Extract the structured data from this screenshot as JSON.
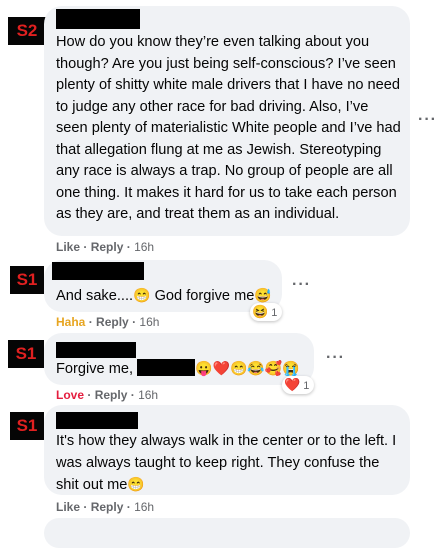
{
  "comments": [
    {
      "badge": "S2",
      "text": "How do you know they’re even talking about you though? Are you just being self-conscious? I’ve seen plenty of shitty white male drivers that I have no need to judge any other race for bad driving. Also, I’ve seen plenty of materialistic White people and I’ve had that allegation flung at me as Jewish. Stereotyping any race is always a trap. No group of people are all one thing. It makes it hard for us to take each person as they are, and treat them as an individual.",
      "reaction": "Like",
      "reply": "Reply",
      "time": "16h"
    },
    {
      "badge": "S1",
      "text_before": "And sake....",
      "text_middle": " God forgive me",
      "emoji_1": "😁",
      "emoji_2": "😅",
      "reaction": "Haha",
      "reply": "Reply",
      "time": "16h",
      "reaction_icon": "😆",
      "reaction_count": "1"
    },
    {
      "badge": "S1",
      "text_before": "Forgive me,",
      "emojis": "😛❤️😁😂🥰😭",
      "reaction": "Love",
      "reply": "Reply",
      "time": "16h",
      "reaction_icon": "❤️",
      "reaction_count": "1"
    },
    {
      "badge": "S1",
      "text": "It's how they always walk in the center or to the left. I was always taught to keep right. They confuse the shit out me",
      "emoji": "😁",
      "reaction": "Like",
      "reply": "Reply",
      "time": "16h"
    }
  ],
  "separator": "·",
  "more_dots": "···"
}
